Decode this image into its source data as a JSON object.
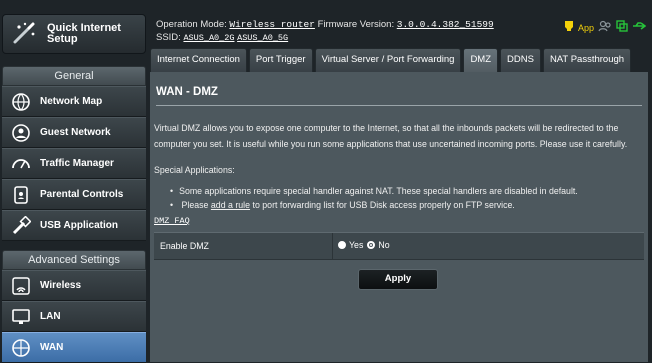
{
  "sidebar": {
    "quick_setup": "Quick Internet Setup",
    "general_header": "General",
    "general_items": [
      {
        "label": "Network Map",
        "icon": "network-map-icon"
      },
      {
        "label": "Guest Network",
        "icon": "guest-network-icon"
      },
      {
        "label": "Traffic Manager",
        "icon": "traffic-manager-icon"
      },
      {
        "label": "Parental Controls",
        "icon": "parental-controls-icon"
      },
      {
        "label": "USB Application",
        "icon": "usb-application-icon"
      }
    ],
    "advanced_header": "Advanced Settings",
    "advanced_items": [
      {
        "label": "Wireless",
        "icon": "wireless-icon"
      },
      {
        "label": "LAN",
        "icon": "lan-icon"
      },
      {
        "label": "WAN",
        "icon": "wan-icon"
      }
    ]
  },
  "topbar": {
    "op_mode_label": "Operation Mode:",
    "op_mode_value": "Wireless router",
    "firmware_label": "Firmware Version:",
    "firmware_value": "3.0.0.4.382_51599",
    "ssid_label": "SSID:",
    "ssid_1": "ASUS_A0_2G",
    "ssid_2": "ASUS_A0_5G",
    "app_label": "App"
  },
  "tabs": [
    "Internet Connection",
    "Port Trigger",
    "Virtual Server / Port Forwarding",
    "DMZ",
    "DDNS",
    "NAT Passthrough"
  ],
  "content": {
    "title": "WAN - DMZ",
    "description": "Virtual DMZ allows you to expose one computer to the Internet, so that all the inbounds packets will be redirected to the computer you set. It is useful while you run some applications that use uncertained incoming ports. Please use it carefully.",
    "special_header": "Special Applications:",
    "bullet_1": "Some applications require special handler against NAT. These special handlers are disabled in default.",
    "bullet_2_pre": "Please",
    "bullet_2_link": "add a rule",
    "bullet_2_post": "to port forwarding list for USB Disk access properly on FTP service.",
    "faq": "DMZ FAQ",
    "enable_label": "Enable DMZ",
    "option_yes": "Yes",
    "option_no": "No",
    "selected": "No",
    "apply": "Apply"
  },
  "colors": {
    "active_menu": "#4a7bb4",
    "app_icon": "#f4d10a",
    "status_green": "#27c23a"
  }
}
